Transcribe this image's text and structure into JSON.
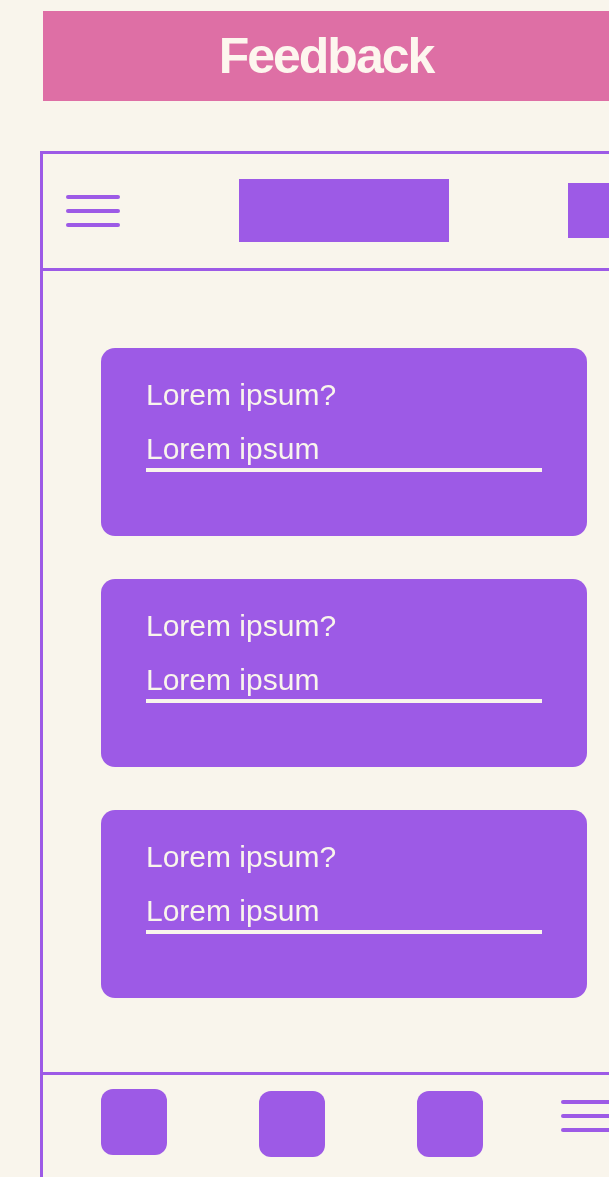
{
  "title": "Feedback",
  "questions": [
    {
      "question": "Lorem ipsum?",
      "answer": "Lorem ipsum"
    },
    {
      "question": "Lorem ipsum?",
      "answer": "Lorem ipsum"
    },
    {
      "question": "Lorem ipsum?",
      "answer": "Lorem ipsum"
    }
  ]
}
